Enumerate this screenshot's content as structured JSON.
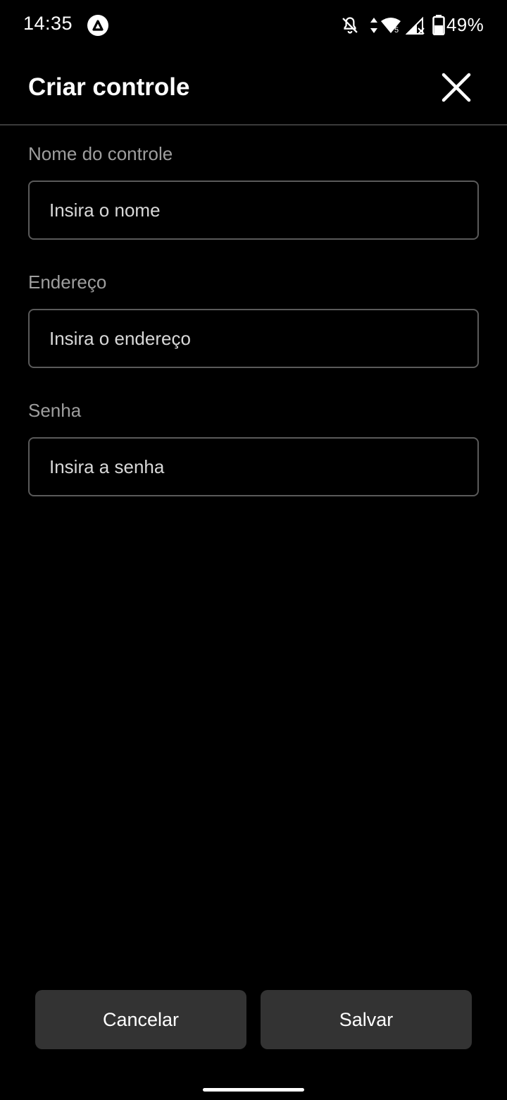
{
  "status_bar": {
    "time": "14:35",
    "battery_percent": "49%",
    "network_label": "5",
    "icons": [
      "app-a-icon",
      "notifications-off-icon",
      "data-arrows-icon",
      "wifi-icon",
      "signal-icon",
      "battery-icon"
    ]
  },
  "header": {
    "title": "Criar controle",
    "close_icon": "close-icon"
  },
  "form": {
    "name_label": "Nome do controle",
    "name_placeholder": "Insira o nome",
    "name_value": "",
    "address_label": "Endereço",
    "address_placeholder": "Insira o endereço",
    "address_value": "",
    "password_label": "Senha",
    "password_placeholder": "Insira a senha",
    "password_value": ""
  },
  "actions": {
    "cancel_label": "Cancelar",
    "save_label": "Salvar"
  },
  "colors": {
    "background": "#000000",
    "button_bg": "#333333",
    "label_gray": "#9e9e9e",
    "input_border": "#5a5a5a"
  }
}
